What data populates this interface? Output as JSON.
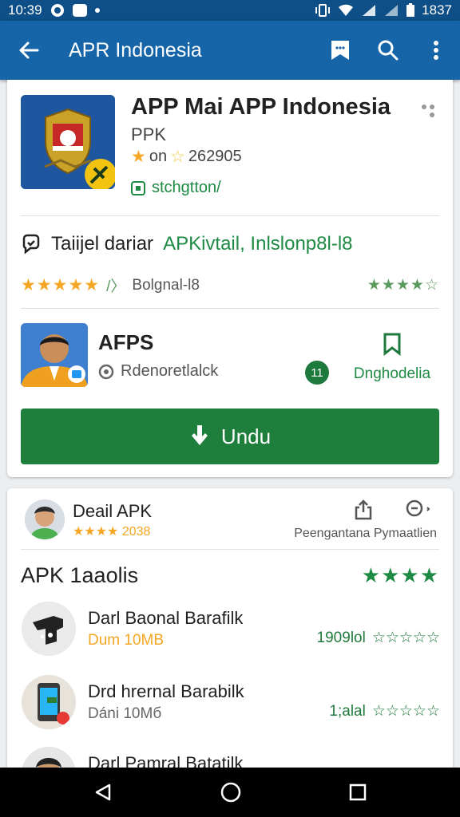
{
  "status_bar": {
    "time_left": "10:39",
    "time_right": "1837"
  },
  "app_bar": {
    "title": "APR Indonesia",
    "icons": [
      "back-arrow-icon",
      "bookmark-icon",
      "search-icon",
      "more-vert-icon"
    ]
  },
  "app_card": {
    "title": "APP Mai APP Indonesia",
    "subtitle": "PPK",
    "rating_prefix": "on",
    "rating_count": "262905",
    "status": "stchgtton/",
    "developer_line_prefix": "Taiijel dariar",
    "developer_line_highlight": "APKivtail, Inlslonp8l-l8",
    "rating_label": "Bolgnal-l8",
    "rating_stars": 4.5,
    "right_stars": 4.5,
    "publisher": {
      "name": "AFPS",
      "location": "Rdenoretlalck",
      "count": "11",
      "bookmark_label": "Dnghodelia"
    },
    "download_button": "Undu"
  },
  "detail_card": {
    "title": "Deail APK",
    "rating_text": "2038",
    "share_label": "Peengantana Pymaatlien",
    "section_title": "APK 1aaolis",
    "section_stars": 4,
    "items": [
      {
        "title": "Darl Baonal Barafilk",
        "size": "Dum 10MB",
        "count": "1909lol",
        "stars": 5,
        "accent": true
      },
      {
        "title": "Drd hrernal Barabilk",
        "size": "Dáni 10Mб",
        "count": "1;alal",
        "stars": 5,
        "accent": false
      },
      {
        "title": "Darl Pamral Batatilk",
        "size": "",
        "count": "",
        "stars": 0,
        "accent": false
      }
    ]
  },
  "colors": {
    "app_bar": "#1565a8",
    "status_bar": "#0d4f86",
    "accent_green": "#1e7f3c",
    "star_gold": "#f5a623"
  }
}
